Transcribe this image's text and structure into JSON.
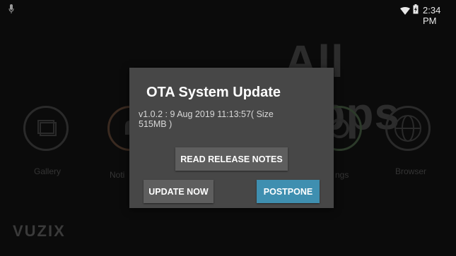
{
  "status_bar": {
    "time": "2:34 PM",
    "icons": [
      "microphone-icon",
      "wifi-icon",
      "battery-icon"
    ]
  },
  "launcher": {
    "title": "All Apps",
    "apps": [
      {
        "label": "Gallery",
        "icon": "gallery-icon"
      },
      {
        "label": "Noti",
        "icon": "notifications-icon"
      },
      {
        "label": "ngs",
        "icon": "settings-icon"
      },
      {
        "label": "Browser",
        "icon": "globe-icon"
      }
    ],
    "brand": "VUZIX"
  },
  "dialog": {
    "title": "OTA System Update",
    "message": "v1.0.2 : 9 Aug 2019 11:13:57( Size 515MB )",
    "buttons": {
      "release_notes": "READ RELEASE NOTES",
      "update_now": "UPDATE NOW",
      "postpone": "POSTPONE"
    }
  },
  "colors": {
    "background": "#0b0b0b",
    "dialog": "#474747",
    "button": "#5e5e5e",
    "accent": "#3f8fb0"
  }
}
